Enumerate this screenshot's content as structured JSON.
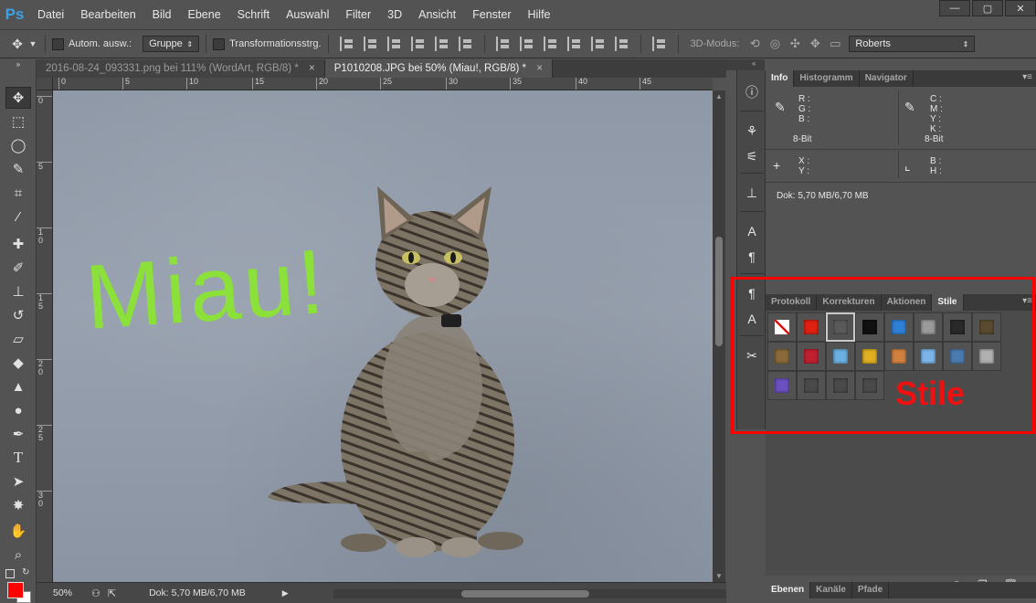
{
  "app": {
    "logo": "Ps"
  },
  "menu": [
    "Datei",
    "Bearbeiten",
    "Bild",
    "Ebene",
    "Schrift",
    "Auswahl",
    "Filter",
    "3D",
    "Ansicht",
    "Fenster",
    "Hilfe"
  ],
  "window_controls": {
    "minimize": "—",
    "maximize": "▢",
    "close": "✕"
  },
  "options_bar": {
    "auto_select_label": "Autom. ausw.:",
    "auto_select_value": "Gruppe",
    "transform_label": "Transformationsstrg.",
    "mode_3d_label": "3D-Modus:",
    "font_select": "Roberts"
  },
  "tabs": [
    {
      "label": "2016-08-24_093331.png bei 111% (WordArt, RGB/8) *",
      "close": "×",
      "active": false
    },
    {
      "label": "P1010208.JPG bei 50% (Miau!, RGB/8) *",
      "close": "×",
      "active": true
    }
  ],
  "ruler_h_labels": [
    "0",
    "5",
    "10",
    "15",
    "20",
    "25",
    "30",
    "35",
    "40",
    "45"
  ],
  "ruler_v_labels": [
    "0",
    "5",
    "1\n0",
    "1\n5",
    "2\n0",
    "2\n5",
    "3\n0"
  ],
  "canvas_text": "Miau!",
  "status": {
    "zoom": "50%",
    "doc": "Dok: 5,70 MB/6,70 MB"
  },
  "info_panel": {
    "tabs": [
      "Info",
      "Histogramm",
      "Navigator"
    ],
    "rgb_labels": [
      "R :",
      "G :",
      "B :"
    ],
    "cmyk_labels": [
      "C :",
      "M :",
      "Y :",
      "K :"
    ],
    "bit_left": "8-Bit",
    "bit_right": "8-Bit",
    "xy_labels": [
      "X :",
      "Y :"
    ],
    "bh_labels": [
      "B :",
      "H :"
    ],
    "doc": "Dok: 5,70 MB/6,70 MB"
  },
  "styles_panel": {
    "tabs": [
      "Protokoll",
      "Korrekturen",
      "Aktionen",
      "Stile"
    ],
    "swatches": [
      {
        "name": "none-style",
        "color": "none"
      },
      {
        "name": "red-glow",
        "color": "#e02010"
      },
      {
        "name": "dark-frame",
        "color": "#4a4a4a"
      },
      {
        "name": "black-button",
        "color": "#111111"
      },
      {
        "name": "blue-glass",
        "color": "#2f7fd6"
      },
      {
        "name": "gray-bevel",
        "color": "#9a9a9a"
      },
      {
        "name": "dark-gradient",
        "color": "#2a2a2a"
      },
      {
        "name": "brown-texture",
        "color": "#5a4a30"
      },
      {
        "name": "bronze",
        "color": "#8a6a3a"
      },
      {
        "name": "red-stripes",
        "color": "#c02030"
      },
      {
        "name": "multicolor",
        "color": "#6ab0e0"
      },
      {
        "name": "gold",
        "color": "#e0b020"
      },
      {
        "name": "orange-gradient",
        "color": "#d08040"
      },
      {
        "name": "light-blue",
        "color": "#7ab4e8"
      },
      {
        "name": "sunset",
        "color": "#4a7ab0"
      },
      {
        "name": "gray-noise",
        "color": "#b0b0b0"
      },
      {
        "name": "purple-blue",
        "color": "#6a50c0"
      },
      {
        "name": "empty-1",
        "color": "#4a4a4a"
      },
      {
        "name": "empty-2",
        "color": "#4a4a4a"
      },
      {
        "name": "empty-3",
        "color": "#4a4a4a"
      }
    ]
  },
  "bottom_panel": {
    "tabs": [
      "Ebenen",
      "Kanäle",
      "Pfade"
    ]
  },
  "annotation": {
    "label": "Stile",
    "color": "#ff0000"
  }
}
